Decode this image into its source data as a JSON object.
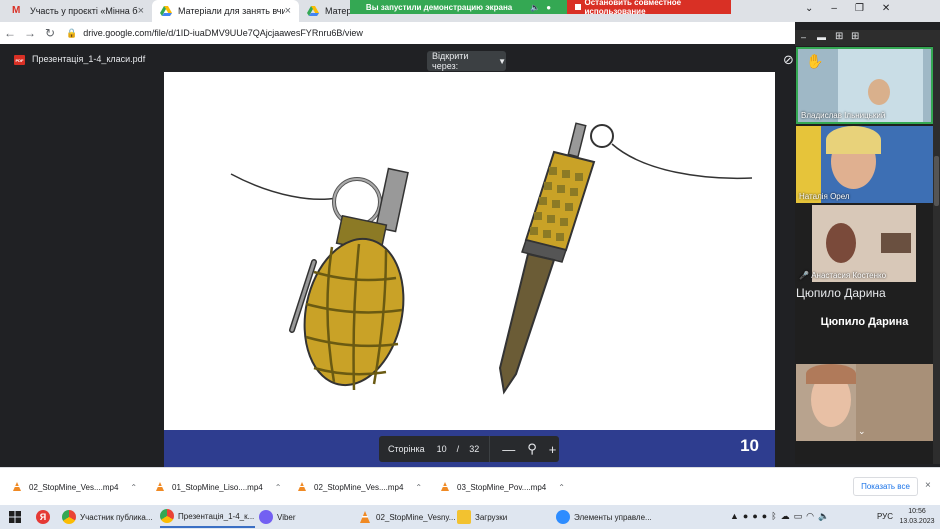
{
  "browser": {
    "tabs": [
      {
        "label": "Участь у проєкті «Мінна безпе",
        "close": "×"
      },
      {
        "label": "Матеріали для занять вчителя –",
        "close": "×"
      },
      {
        "label": "Матері",
        "close": ""
      }
    ],
    "url": "drive.google.com/file/d/1ID-iuaDMV9UUe7QAjcjaawesFYRnru6B/view"
  },
  "screen_share": {
    "banner": "Вы запустили демонстрацию экрана",
    "stop_label": "Остановить совместное использование"
  },
  "viewer": {
    "file_title": "Презентація_1-4_класи.pdf",
    "pdf_badge": "PDF",
    "open_with": "Відкрити через:",
    "slide_number": "10",
    "pager": {
      "label": "Сторінка",
      "current": "10",
      "separator": "/",
      "total": "32",
      "zoom_out": "—",
      "zoom_in": "+"
    }
  },
  "participants": [
    {
      "name": "Владислав Ільницький"
    },
    {
      "name": "Наталія Орел"
    },
    {
      "name": "Анастасия Костенко"
    },
    {
      "name": "Цюпило Дарина",
      "display_big": "Цюпило Дарина"
    },
    {
      "name": ""
    }
  ],
  "downloads": {
    "items": [
      {
        "name": "02_StopMine_Ves....mp4"
      },
      {
        "name": "01_StopMine_Liso....mp4"
      },
      {
        "name": "02_StopMine_Ves....mp4"
      },
      {
        "name": "03_StopMine_Pov....mp4"
      }
    ],
    "show_all": "Показать все",
    "close": "×"
  },
  "taskbar": {
    "items": [
      {
        "label": "Участник публика..."
      },
      {
        "label": "Презентація_1-4_к..."
      },
      {
        "label": "Viber"
      },
      {
        "label": "02_StopMine_Vesny..."
      },
      {
        "label": "Загрузки"
      },
      {
        "label": "Элементы управле..."
      }
    ],
    "lang": "РУС",
    "time": "10:56",
    "date": "13.03.2023"
  },
  "colors": {
    "accent": "#2e3d8f",
    "share_green": "#34a853",
    "stop_red": "#d93025",
    "grenade_yellow": "#c9a227"
  }
}
